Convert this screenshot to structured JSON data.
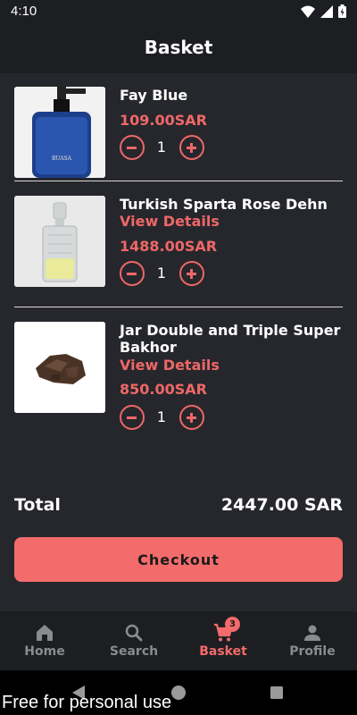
{
  "status_bar": {
    "time": "4:10"
  },
  "app_bar": {
    "title": "Basket"
  },
  "items": [
    {
      "name": "Fay Blue",
      "view_details": "",
      "price": "109.00SAR",
      "qty": "1",
      "image": "blue-spray-bottle"
    },
    {
      "name": "Turkish Sparta Rose Dehn",
      "view_details": "View Details",
      "price": "1488.00SAR",
      "qty": "1",
      "image": "glass-decanter"
    },
    {
      "name": "Jar Double and Triple Super Bakhor",
      "view_details": "View Details",
      "price": "850.00SAR",
      "qty": "1",
      "image": "bakhor-chips"
    }
  ],
  "total": {
    "label": "Total",
    "value": "2447.00 SAR"
  },
  "checkout": {
    "label": "Checkout"
  },
  "bottom_nav": [
    {
      "label": "Home",
      "icon": "home-icon"
    },
    {
      "label": "Search",
      "icon": "search-icon"
    },
    {
      "label": "Basket",
      "icon": "cart-icon",
      "badge": "3",
      "active": true
    },
    {
      "label": "Profile",
      "icon": "person-icon"
    }
  ],
  "watermark": "Free for personal use",
  "colors": {
    "accent": "#f36b6b",
    "background": "#26272c",
    "bar": "#1d1e22"
  }
}
